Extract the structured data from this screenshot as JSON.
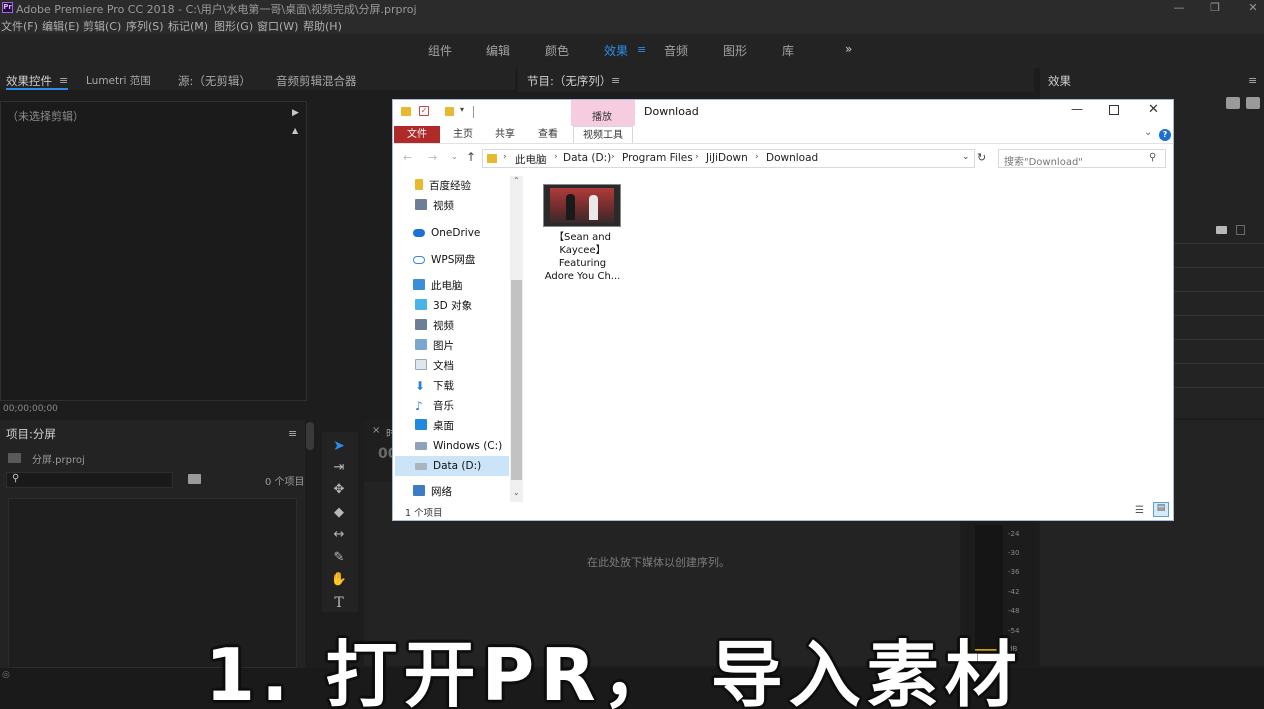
{
  "titlebar": {
    "title": "Adobe Premiere Pro CC 2018 - C:\\用户\\水电第一哥\\桌面\\视频完成\\分屏.prproj",
    "logo": "Pr"
  },
  "menu": [
    "文件(F)",
    "编辑(E)",
    "剪辑(C)",
    "序列(S)",
    "标记(M)",
    "图形(G)",
    "窗口(W)",
    "帮助(H)"
  ],
  "workspaces": [
    "组件",
    "编辑",
    "颜色",
    "效果",
    "音频",
    "图形",
    "库"
  ],
  "workspace_active": "效果",
  "workspace_more": "»",
  "effect_controls": {
    "tabs": [
      "效果控件",
      "Lumetri 范围",
      "源:（无剪辑）",
      "音频剪辑混合器"
    ],
    "no_clip": "（未选择剪辑）",
    "timecode": "00;00;00;00"
  },
  "program": {
    "title": "节目:（无序列）"
  },
  "effects": {
    "title": "效果"
  },
  "project": {
    "title": "项目:分屏",
    "file": "分屏.prproj",
    "count": "0 个项目"
  },
  "timeline": {
    "drop_hint": "在此处放下媒体以创建序列。",
    "tab_prefix": "时",
    "timecode_fragment": "00"
  },
  "meter_scale": [
    "-24",
    "-30",
    "-36",
    "-42",
    "-48",
    "-54",
    "dB"
  ],
  "explorer": {
    "context_tab": "播放",
    "window_title": "Download",
    "ribbon_tabs": [
      "文件",
      "主页",
      "共享",
      "查看",
      "视频工具"
    ],
    "breadcrumb": [
      "此电脑",
      "Data (D:)",
      "Program Files",
      "JiJiDown",
      "Download"
    ],
    "search_placeholder": "搜索\"Download\"",
    "nav": [
      {
        "label": "百度经验",
        "icon": "folder-icon"
      },
      {
        "label": "视频",
        "icon": "video-folder-icon"
      },
      {
        "label": "OneDrive",
        "icon": "cloud-icon"
      },
      {
        "label": "WPS网盘",
        "icon": "cloud-outline-icon"
      },
      {
        "label": "此电脑",
        "icon": "computer-icon"
      },
      {
        "label": "3D 对象",
        "icon": "cube-icon"
      },
      {
        "label": "视频",
        "icon": "video-folder-icon"
      },
      {
        "label": "图片",
        "icon": "pictures-icon"
      },
      {
        "label": "文档",
        "icon": "documents-icon"
      },
      {
        "label": "下载",
        "icon": "download-icon"
      },
      {
        "label": "音乐",
        "icon": "music-icon"
      },
      {
        "label": "桌面",
        "icon": "desktop-icon"
      },
      {
        "label": "Windows (C:)",
        "icon": "windows-drive-icon"
      },
      {
        "label": "Data (D:)",
        "icon": "drive-icon"
      },
      {
        "label": "网络",
        "icon": "network-icon"
      }
    ],
    "selected_nav": "Data (D:)",
    "file": {
      "name_lines": [
        "【Sean and",
        "Kaycee】",
        "Featuring",
        "Adore You Ch..."
      ]
    },
    "status": "1 个项目"
  },
  "subtitle": "1. 打开PR， 导入素材",
  "colors": {
    "accent_blue": "#2d8ceb",
    "file_tab_red": "#b02a2a",
    "context_tab_pink": "#f6cde0"
  }
}
